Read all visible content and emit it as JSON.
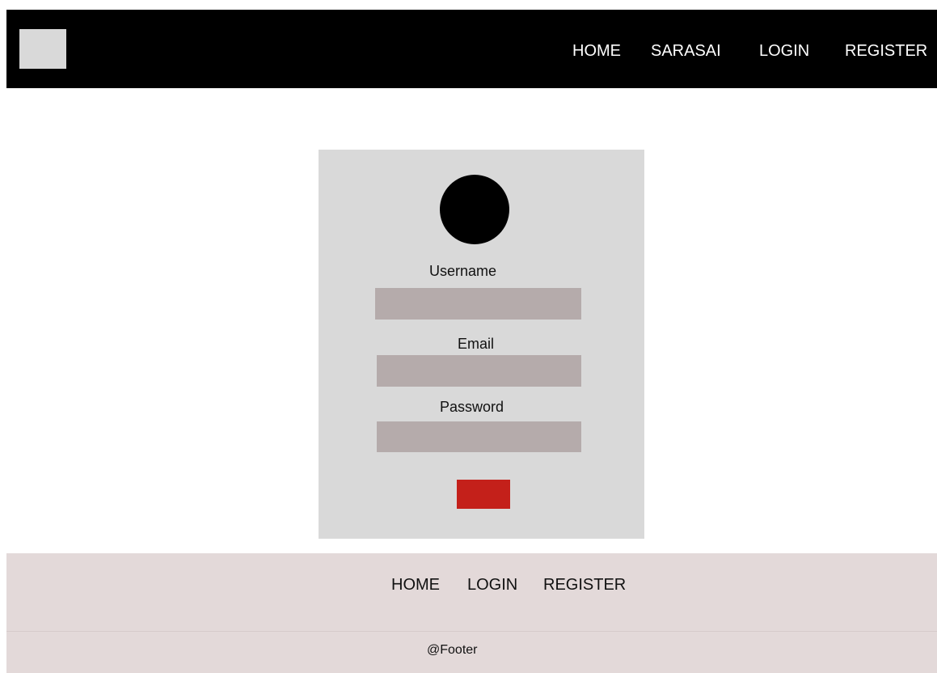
{
  "header": {
    "nav": [
      {
        "label": "HOME"
      },
      {
        "label": "SARASAI"
      },
      {
        "label": "LOGIN"
      },
      {
        "label": "REGISTER"
      }
    ]
  },
  "form": {
    "username": {
      "label": "Username",
      "value": "",
      "placeholder": ""
    },
    "email": {
      "label": "Email",
      "value": "",
      "placeholder": ""
    },
    "password": {
      "label": "Password",
      "value": "",
      "placeholder": ""
    },
    "submit_label": ""
  },
  "footer": {
    "nav": [
      {
        "label": "HOME"
      },
      {
        "label": "LOGIN"
      },
      {
        "label": "REGISTER"
      }
    ],
    "copyright": "@Footer"
  },
  "colors": {
    "header_bg": "#000000",
    "card_bg": "#d9d9d9",
    "input_bg": "#b5abab",
    "submit_button": "#c4201a",
    "footer_bg": "#e3d9d9"
  }
}
